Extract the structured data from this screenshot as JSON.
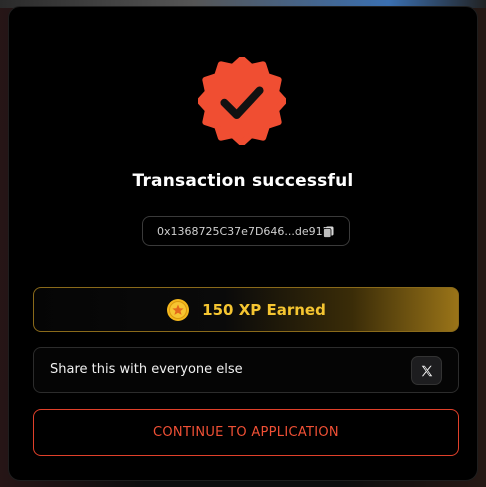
{
  "modal": {
    "title": "Transaction successful",
    "transaction_hash": "0x1368725C37e7D646...de91D",
    "xp": {
      "label": "150 XP Earned",
      "coin_icon": "star-coin-icon"
    },
    "share": {
      "label": "Share this with everyone else",
      "icon": "x-logo-icon"
    },
    "continue_label": "CONTINUE TO APPLICATION"
  },
  "colors": {
    "accent": "#f04e32",
    "gold": "#f5c531",
    "background": "#000000"
  }
}
